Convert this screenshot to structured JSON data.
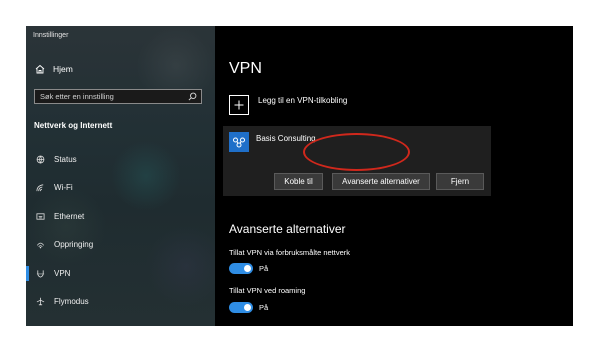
{
  "window": {
    "title": "Innstillinger"
  },
  "sidebar": {
    "home_label": "Hjem",
    "search_placeholder": "Søk etter en innstilling",
    "section_title": "Nettverk og Internett",
    "items": [
      {
        "label": "Status",
        "icon": "status-icon"
      },
      {
        "label": "Wi-Fi",
        "icon": "wifi-icon"
      },
      {
        "label": "Ethernet",
        "icon": "ethernet-icon"
      },
      {
        "label": "Oppringing",
        "icon": "dialup-icon"
      },
      {
        "label": "VPN",
        "icon": "vpn-icon",
        "selected": true
      },
      {
        "label": "Flymodus",
        "icon": "airplane-icon"
      }
    ],
    "accent": "#2f8de4"
  },
  "main": {
    "title": "VPN",
    "add_vpn_label": "Legg til en VPN-tilkobling",
    "connection": {
      "name": "Basis Consulting",
      "connect_label": "Koble til",
      "advanced_label": "Avanserte alternativer",
      "remove_label": "Fjern"
    },
    "advanced": {
      "title": "Avanserte alternativer",
      "option1_label": "Tillat VPN via forbruksmålte nettverk",
      "option1_state": "På",
      "option2_label": "Tillat VPN ved roaming",
      "option2_state": "På"
    },
    "highlight_color": "#d0281c"
  }
}
